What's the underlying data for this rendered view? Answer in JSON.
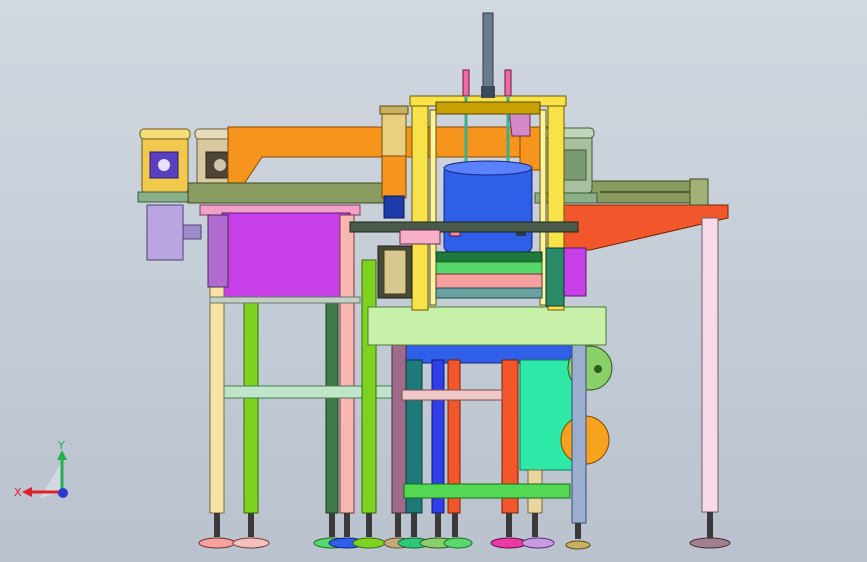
{
  "view": {
    "type": "cad-3d-assembly-front-view",
    "background_top": "#d2d8e0",
    "background_bottom": "#b9c2cd"
  },
  "triad": {
    "x_label": "X",
    "y_label": "Y",
    "x_color": "#e0202a",
    "y_color": "#22b24c",
    "z_color": "#2a3ad0"
  },
  "palette": {
    "frame_orange": "#f7941d",
    "motor_gold": "#f2c94c",
    "motor_tan": "#d9c9a0",
    "motor_purple": "#5a3fc0",
    "gearbox_lavender": "#b9a6e0",
    "magenta_box": "#c73fe6",
    "lime": "#7ed321",
    "pale_green_platform": "#c8f0a8",
    "blue_drum": "#2f5ee8",
    "table_red_orange": "#f2572b",
    "mint": "#2ee8a8",
    "pale_pink_leg": "#f3dbe8",
    "yellow_frame": "#f7e24a"
  }
}
